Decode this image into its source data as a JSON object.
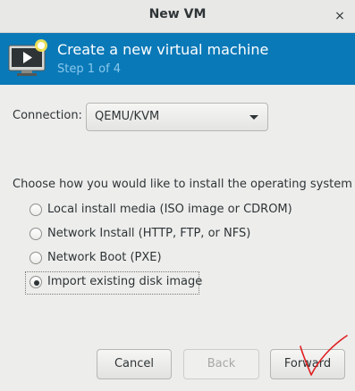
{
  "window": {
    "title": "New VM",
    "close_icon": "×"
  },
  "banner": {
    "title": "Create a new virtual machine",
    "step": "Step 1 of 4",
    "icon": "vm-monitor-icon",
    "bg_color": "#0a79b8"
  },
  "connection": {
    "label": "Connection:",
    "value": "QEMU/KVM"
  },
  "install": {
    "prompt": "Choose how you would like to install the operating system",
    "options": [
      {
        "label": "Local install media (ISO image or CDROM)",
        "selected": false
      },
      {
        "label": "Network Install (HTTP, FTP, or NFS)",
        "selected": false
      },
      {
        "label": "Network Boot (PXE)",
        "selected": false
      },
      {
        "label": "Import existing disk image",
        "selected": true
      }
    ]
  },
  "buttons": {
    "cancel": "Cancel",
    "back": "Back",
    "forward": "Forward"
  }
}
